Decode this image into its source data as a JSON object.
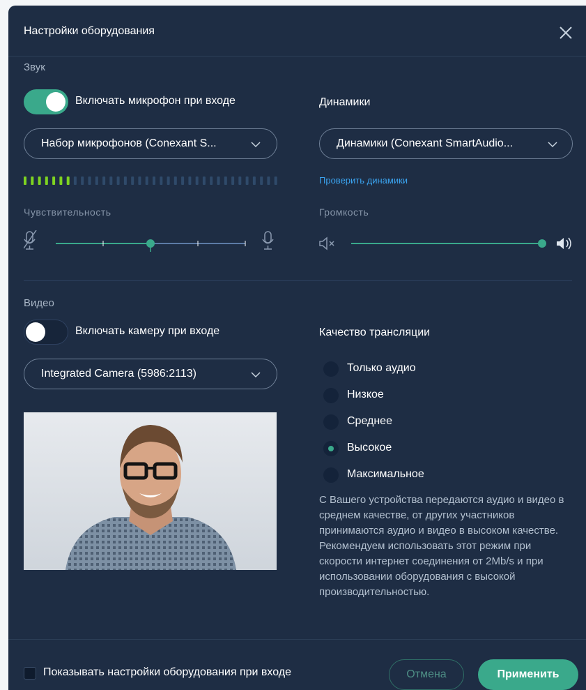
{
  "dialog": {
    "title": "Настройки оборудования"
  },
  "audio": {
    "section_label": "Звук",
    "mic_toggle_label": "Включать микрофон при входе",
    "mic_enabled": true,
    "mic_select_value": "Набор микрофонов (Conexant S...",
    "level_meter": {
      "active_fraction": 0.19
    },
    "sensitivity_label": "Чувствительность",
    "sensitivity": {
      "value": 0.5
    },
    "speakers_label": "Динамики",
    "speaker_select_value": "Динамики (Conexant SmartAudio...",
    "test_speakers_link": "Проверить динамики",
    "volume_label": "Громкость",
    "volume": {
      "value": 1.0
    }
  },
  "video": {
    "section_label": "Видео",
    "camera_toggle_label": "Включать камеру при входе",
    "camera_enabled": false,
    "camera_select_value": "Integrated Camera (5986:2113)",
    "quality_label": "Качество трансляции",
    "quality_options": [
      {
        "label": "Только аудио",
        "checked": false
      },
      {
        "label": "Низкое",
        "checked": false
      },
      {
        "label": "Среднее",
        "checked": false
      },
      {
        "label": "Высокое",
        "checked": true
      },
      {
        "label": "Максимальное",
        "checked": false
      }
    ],
    "quality_description": "С Вашего устройства передаются аудио и видео в среднем качестве, от других участников принимаются аудио и видео в высоком качестве. Рекомендуем использовать этот режим при скорости интернет соединения от 2Mb/s и при использовании оборудования с высокой производительностью."
  },
  "footer": {
    "show_on_entry_label": "Показывать настройки оборудования при входе",
    "show_on_entry_checked": false,
    "cancel_label": "Отмена",
    "apply_label": "Применить"
  },
  "colors": {
    "background": "#1e2d44",
    "accent": "#3aa98b",
    "link": "#3ba4f0",
    "meter_active": "#7ed321",
    "meter_inactive": "#2f4a6a"
  },
  "icons": [
    "close-icon",
    "chevron-down-icon",
    "mic-muted-icon",
    "mic-icon",
    "speaker-muted-icon",
    "speaker-loud-icon"
  ]
}
